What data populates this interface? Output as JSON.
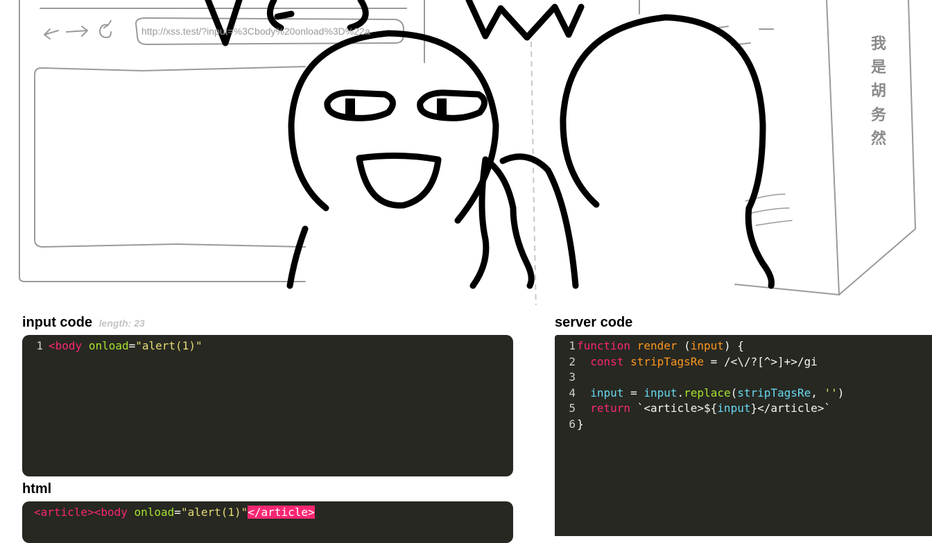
{
  "browser": {
    "url": "http://xss.test/?input=%3Cbody%20onload%3D%22a"
  },
  "comic": {
    "side_text": [
      "我",
      "是",
      "胡",
      "务",
      "然"
    ]
  },
  "input_panel": {
    "title": "input code",
    "length_label": "length: 23",
    "lines": [
      {
        "num": "1",
        "tag_open": "<body",
        "attr": "onload",
        "eq": "=",
        "str": "\"alert(1)\""
      }
    ]
  },
  "server_panel": {
    "title": "server code",
    "lines": [
      {
        "num": "1"
      },
      {
        "num": "2"
      },
      {
        "num": "3"
      },
      {
        "num": "4"
      },
      {
        "num": "5"
      },
      {
        "num": "6"
      }
    ],
    "tokens": {
      "function_kw": "function",
      "fn_name": "render",
      "paren_open": " (",
      "param": "input",
      "paren_close": ") {",
      "const_kw": "const",
      "const_name": "stripTagsRe",
      "regex": " = /<\\/?[^>]+>/gi",
      "input_var": "input",
      "assign": " = ",
      "input_var2": "input",
      "dot": ".",
      "method": "replace",
      "open": "(",
      "arg": "stripTagsRe",
      "comma": ", ",
      "empty_str": "''",
      "close": ")",
      "return_kw": "return",
      "template_start": " `<article>${",
      "template_var": "input",
      "template_end": "}</article>`",
      "brace_close": "}"
    }
  },
  "html_panel": {
    "title": "html",
    "tag_open": "<article><body",
    "attr": "onload",
    "eq": "=",
    "str": "\"alert(1)\"",
    "tag_close": "</article>"
  }
}
